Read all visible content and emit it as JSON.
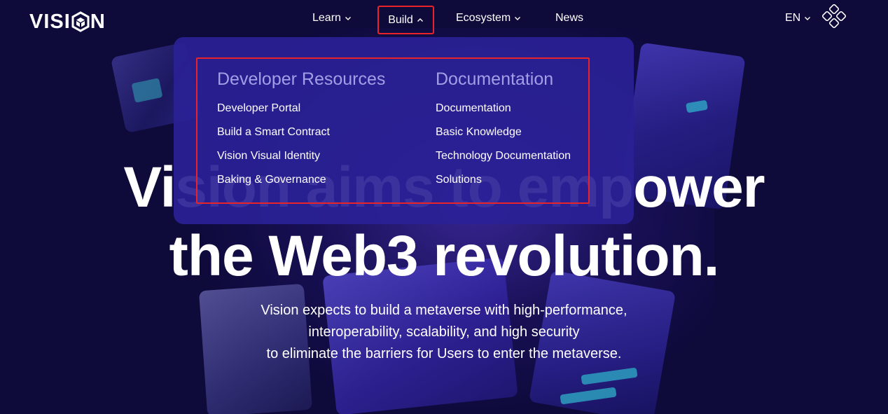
{
  "header": {
    "logo_text_left": "VISI",
    "logo_text_right": "N",
    "nav": [
      {
        "label": "Learn",
        "icon": "chevron-down-icon"
      },
      {
        "label": "Build",
        "icon": "chevron-up-icon"
      },
      {
        "label": "Ecosystem",
        "icon": "chevron-down-icon"
      },
      {
        "label": "News"
      }
    ],
    "language": "EN",
    "menu_icon": "four-diamonds-icon"
  },
  "dropdown": {
    "columns": [
      {
        "heading": "Developer Resources",
        "links": [
          "Developer Portal",
          "Build a Smart Contract",
          "Vision Visual Identity",
          "Baking & Governance"
        ]
      },
      {
        "heading": "Documentation",
        "links": [
          "Documentation",
          "Basic Knowledge",
          "Technology Documentation",
          "Solutions"
        ]
      }
    ]
  },
  "hero": {
    "title_line1": "Vision aims to empower",
    "title_line2": "the Web3 revolution.",
    "subtitle_line1": "Vision expects to build a metaverse with high-performance,",
    "subtitle_line2": "interoperability, scalability, and high security",
    "subtitle_line3": "to eliminate the barriers for Users to enter the metaverse."
  },
  "colors": {
    "background": "#0e0a3a",
    "dropdown_bg": "#2a2196",
    "heading": "#a39ee6",
    "highlight": "#e8232a"
  }
}
